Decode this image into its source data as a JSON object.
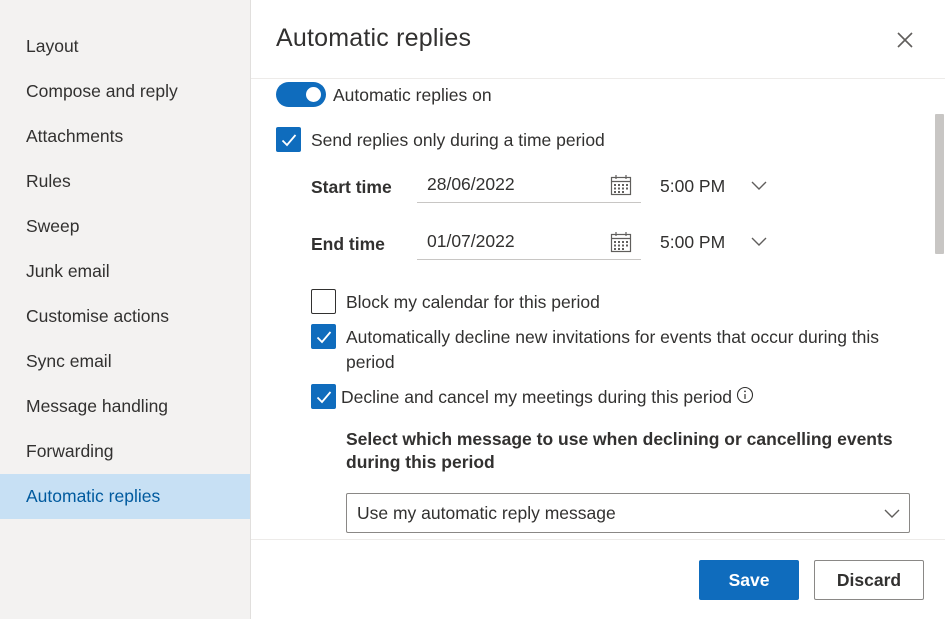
{
  "sidebar": {
    "items": [
      {
        "label": "Layout"
      },
      {
        "label": "Compose and reply"
      },
      {
        "label": "Attachments"
      },
      {
        "label": "Rules"
      },
      {
        "label": "Sweep"
      },
      {
        "label": "Junk email"
      },
      {
        "label": "Customise actions"
      },
      {
        "label": "Sync email"
      },
      {
        "label": "Message handling"
      },
      {
        "label": "Forwarding"
      },
      {
        "label": "Automatic replies",
        "active": true
      }
    ]
  },
  "panel": {
    "title": "Automatic replies",
    "toggle": {
      "label": "Automatic replies on",
      "on": true
    },
    "time_period": {
      "label": "Send replies only during a time period",
      "checked": true
    },
    "start": {
      "label": "Start time",
      "date": "28/06/2022",
      "time": "5:00 PM"
    },
    "end": {
      "label": "End time",
      "date": "01/07/2022",
      "time": "5:00 PM"
    },
    "block_calendar": {
      "label": "Block my calendar for this period",
      "checked": false
    },
    "decline_new": {
      "label_line1": "Automatically decline new invitations for events that occur during this",
      "label_line2": "period",
      "checked": true
    },
    "decline_cancel": {
      "label": "Decline and cancel my meetings during this period",
      "checked": true
    },
    "select_message": {
      "heading_line1": "Select which message to use when declining or cancelling events",
      "heading_line2": "during this period",
      "selected": "Use my automatic reply message"
    }
  },
  "footer": {
    "save_label": "Save",
    "discard_label": "Discard"
  },
  "colors": {
    "accent": "#0f6cbd",
    "sidebar_active_bg": "#c7e0f4",
    "sidebar_bg": "#f3f2f1"
  },
  "icons": [
    "close-icon",
    "calendar-icon",
    "chevron-down-icon",
    "checkmark-icon",
    "info-icon"
  ]
}
